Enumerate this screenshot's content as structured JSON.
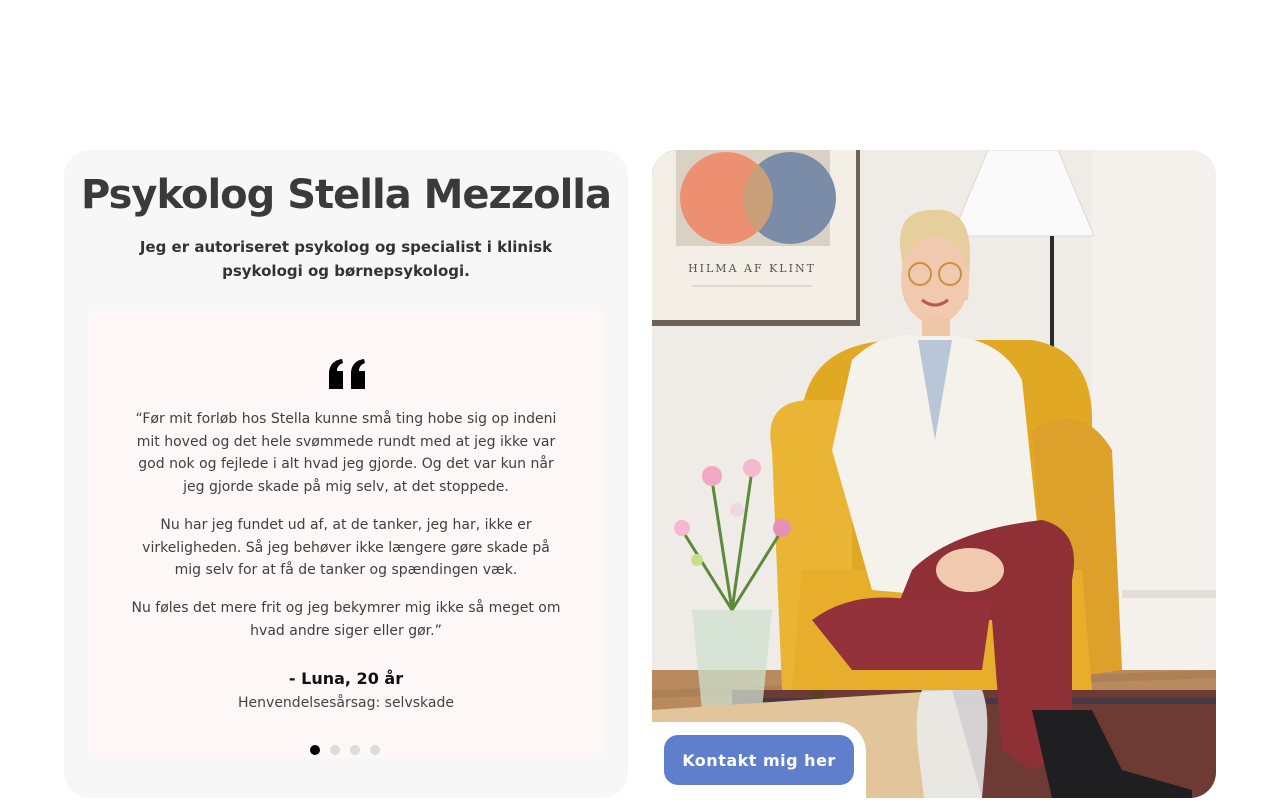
{
  "hero": {
    "title": "Psykolog Stella Mezzolla",
    "subtitle": "Jeg er autoriseret psykolog og specialist i klinisk psykologi og børnepsykologi."
  },
  "testimonial": {
    "quote_icon": "quote-icon",
    "paragraphs": [
      "“Før mit forløb hos Stella kunne små ting hobe sig op indeni mit hoved og det hele svømmede rundt med at jeg ikke var god nok og fejlede i alt hvad jeg gjorde. Og det var kun når jeg gjorde skade på mig selv, at det stoppede.",
      "Nu har jeg fundet ud af, at de tanker, jeg har, ikke er virkeligheden. Så jeg behøver ikke længere gøre skade på mig selv for at få de tanker og spændingen væk.",
      "Nu føles det mere frit og jeg bekymrer mig ikke så meget om hvad andre siger eller gør.”"
    ],
    "author": "- Luna, 20 år",
    "reason": "Henvendelsesårsag: selvskade",
    "slider": {
      "total": 4,
      "active": 1
    }
  },
  "photo": {
    "poster_text": "HILMA AF KLINT"
  },
  "cta": {
    "label": "Kontakt mig her"
  },
  "colors": {
    "accent": "#5f7fcc",
    "card_background": "#f7f7f7",
    "testimonial_background": "#fdf8f7",
    "armchair": "#e8b230",
    "trousers": "#8f2f36"
  }
}
